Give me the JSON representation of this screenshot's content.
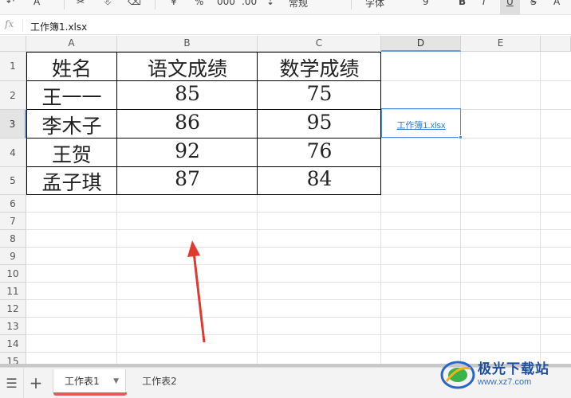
{
  "toolbar": {
    "items": [
      "↶",
      "A",
      "✂",
      "⎀",
      "¥",
      "%",
      "000",
      ".00",
      "⇣",
      "常规",
      "字体",
      "9",
      "B",
      "I",
      "U",
      "S",
      "A"
    ]
  },
  "formula_bar": {
    "fx_label": "fx",
    "value": "工作簿1.xlsx"
  },
  "columns": [
    "A",
    "B",
    "C",
    "D",
    "E"
  ],
  "rows": [
    "1",
    "2",
    "3",
    "4",
    "5",
    "6",
    "7",
    "8",
    "9",
    "10",
    "11",
    "12",
    "13",
    "14",
    "15"
  ],
  "table": {
    "header": [
      "姓名",
      "语文成绩",
      "数学成绩"
    ],
    "body": [
      [
        "王一一",
        "85",
        "75"
      ],
      [
        "李木子",
        "86",
        "95"
      ],
      [
        "王贺",
        "92",
        "76"
      ],
      [
        "孟子琪",
        "87",
        "84"
      ]
    ]
  },
  "hyperlink_cell": {
    "address": "D3",
    "text": "工作簿1.xlsx"
  },
  "sheet_tabs": {
    "menu_icon": "list-icon",
    "add_icon": "plus-icon",
    "tabs": [
      {
        "label": "工作表1",
        "active": true
      },
      {
        "label": "工作表2",
        "active": false
      }
    ]
  },
  "watermark": {
    "line1": "极光下载站",
    "line2": "www.xz7.com"
  },
  "colors": {
    "selection": "#4a8fd9",
    "active_tab_underline": "#e45a5a",
    "annotation_arrow": "#e03a2f",
    "link": "#2e7bd0"
  }
}
